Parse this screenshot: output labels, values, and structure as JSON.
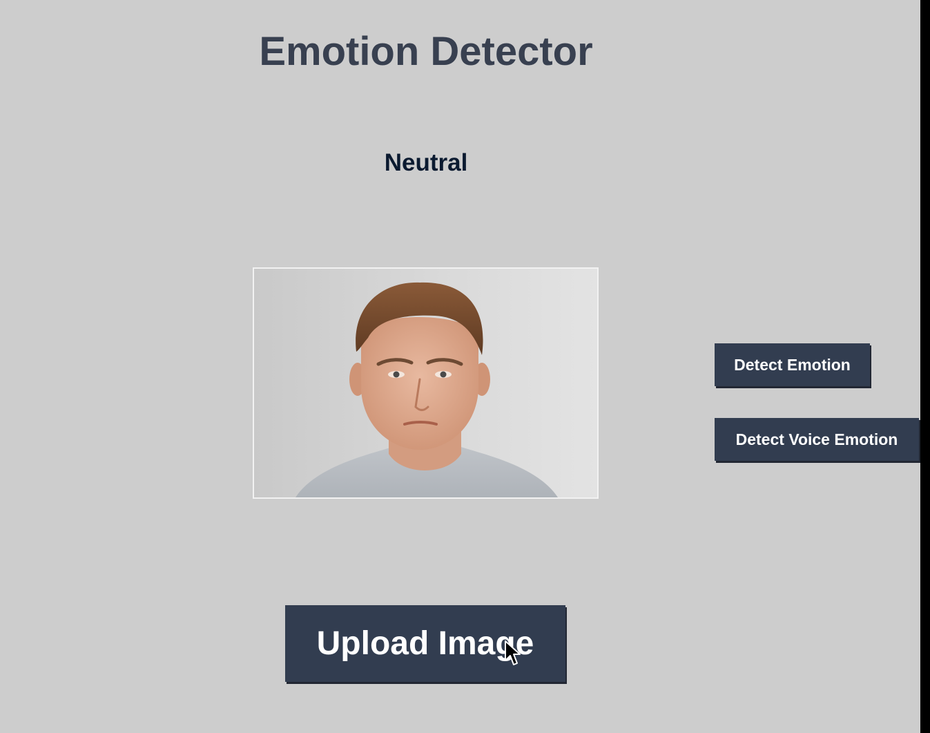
{
  "app": {
    "title": "Emotion Detector"
  },
  "result": {
    "emotion_label": "Neutral"
  },
  "image_panel": {
    "icon": "portrait-photo"
  },
  "buttons": {
    "detect_emotion_label": "Detect Emotion",
    "detect_voice_emotion_label": "Detect Voice Emotion",
    "upload_image_label": "Upload Image"
  },
  "colors": {
    "background": "#cdcdcd",
    "title_text": "#384050",
    "button_bg": "#323d50",
    "button_text": "#ffffff"
  },
  "pointer": {
    "icon": "mouse-cursor-icon"
  }
}
